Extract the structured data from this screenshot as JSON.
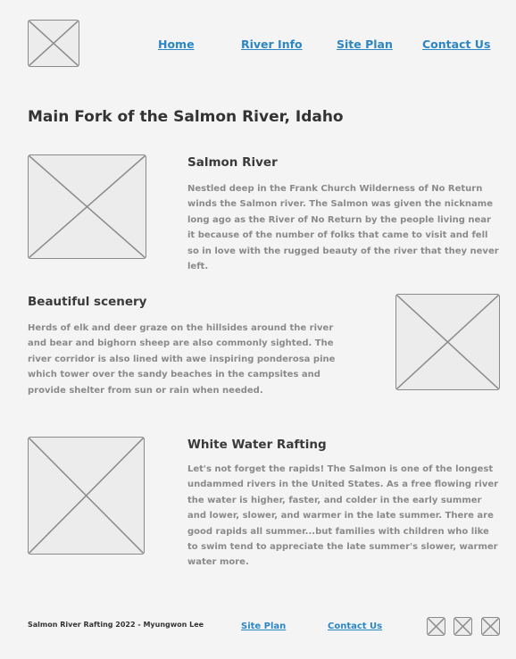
{
  "header": {
    "logo_icon": "image-placeholder-icon",
    "nav": {
      "home": "Home",
      "river_info": "River Info",
      "site_plan": "Site Plan",
      "contact_us": "Contact Us"
    }
  },
  "main": {
    "title": "Main Fork of the Salmon River, Idaho",
    "sections": [
      {
        "heading": "Salmon River",
        "body": "Nestled deep in the Frank Church Wilderness of No Return winds the Salmon river. The Salmon was given the nickname long ago as the River of No Return by the people living near it because of the number of folks that came to visit and fell so in love with the rugged beauty of the river that they never left."
      },
      {
        "heading": "Beautiful scenery",
        "body": "Herds of elk and deer graze on the hillsides around the river and bear and bighorn sheep are also commonly sighted. The river corridor is also lined with awe inspiring ponderosa pine which tower over the sandy beaches in the campsites and provide shelter from sun or rain when needed."
      },
      {
        "heading": "White Water Rafting",
        "body": "Let's not forget the rapids! The Salmon is one of the longest undammed rivers in the United States. As a free flowing river the water is higher, faster, and colder in the early summer and lower, slower, and warmer in the late summer. There are good rapids all summer...but families with children who like to swim tend to appreciate the late summer's slower, warmer water more."
      }
    ]
  },
  "footer": {
    "copyright": "Salmon River  Rafting 2022 - Myungwon Lee",
    "site_plan": "Site Plan",
    "contact_us": "Contact Us",
    "social_icons": [
      "social-placeholder-icon",
      "social-placeholder-icon",
      "social-placeholder-icon"
    ]
  },
  "colors": {
    "link": "#2b86c5",
    "background": "#f4f4f4",
    "heading": "#333333",
    "body_text": "#8a8a8a"
  }
}
